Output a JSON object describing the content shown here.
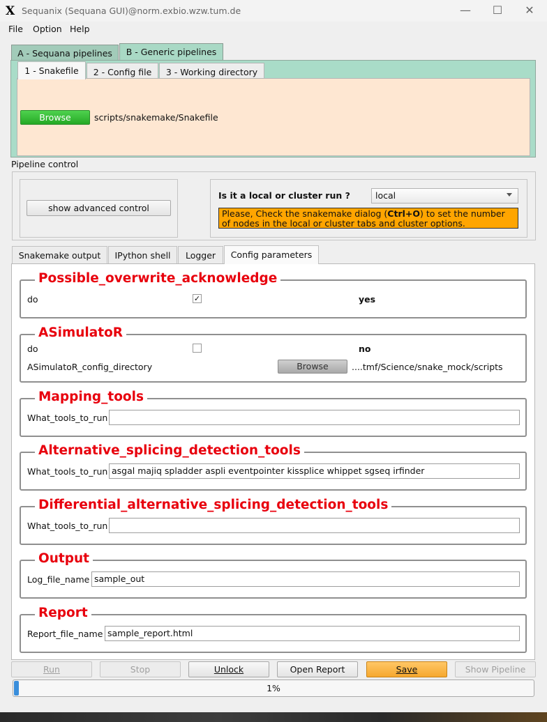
{
  "window": {
    "title": "Sequanix (Sequana GUI)@norm.exbio.wzw.tum.de",
    "icon": "x-logo-icon",
    "controls": [
      "minimize-icon",
      "maximize-icon",
      "close-icon"
    ]
  },
  "menu": [
    {
      "label": "File"
    },
    {
      "label": "Option"
    },
    {
      "label": "Help"
    }
  ],
  "outer_tabs": [
    {
      "label": "A - Sequana pipelines",
      "active": false
    },
    {
      "label": "B - Generic pipelines",
      "active": true
    }
  ],
  "inner_tabs": [
    {
      "label": "1 - Snakefile",
      "active": true
    },
    {
      "label": "2 - Config file",
      "active": false
    },
    {
      "label": "3 - Working directory",
      "active": false
    }
  ],
  "snakefile": {
    "browse_label": "Browse",
    "path": "scripts/snakemake/Snakefile"
  },
  "pipeline_control": {
    "label": "Pipeline control",
    "advanced_button": "show advanced control",
    "run_question": "Is it a local or cluster run ?",
    "run_mode": "local",
    "warning_pre": "Please, Check the snakemake dialog (",
    "warning_key": "Ctrl+O",
    "warning_post": ") to set the number of nodes in the local or cluster tabs and cluster options."
  },
  "lower_tabs": [
    {
      "label": "Snakemake output",
      "active": false
    },
    {
      "label": "IPython shell",
      "active": false
    },
    {
      "label": "Logger",
      "active": false
    },
    {
      "label": "Config parameters",
      "active": true
    }
  ],
  "config": {
    "overwrite": {
      "title": "Possible_overwrite_acknowledge",
      "do_label": "do",
      "do_checked": true,
      "do_value": "yes"
    },
    "asimulator": {
      "title": "ASimulatoR",
      "do_label": "do",
      "do_checked": false,
      "do_value": "no",
      "dir_label": "ASimulatoR_config_directory",
      "browse_label": "Browse",
      "dir_value": "....tmf/Science/snake_mock/scripts"
    },
    "mapping": {
      "title": "Mapping_tools",
      "field_label": "What_tools_to_run",
      "field_value": ""
    },
    "alt_splicing": {
      "title": "Alternative_splicing_detection_tools",
      "field_label": "What_tools_to_run",
      "field_value": "asgal majiq spladder aspli eventpointer kissplice whippet sgseq irfinder"
    },
    "diff_alt_splicing": {
      "title": "Differential_alternative_splicing_detection_tools",
      "field_label": "What_tools_to_run",
      "field_value": ""
    },
    "output": {
      "title": "Output",
      "field_label": "Log_file_name",
      "field_value": "sample_out"
    },
    "report": {
      "title": "Report",
      "field_label": "Report_file_name",
      "field_value": "sample_report.html"
    }
  },
  "actions": {
    "run": "Run",
    "stop": "Stop",
    "unlock": "Unlock",
    "open_report": "Open Report",
    "save": "Save",
    "show_pipeline": "Show Pipeline"
  },
  "progress": {
    "label": "1%",
    "fraction": 0.01
  },
  "colors": {
    "section_title": "#e8000d",
    "browse_green": "#2fb42f",
    "warning_bg": "#ffa500",
    "save_orange": "#f6a82e",
    "progress_fill": "#3a8edb"
  }
}
